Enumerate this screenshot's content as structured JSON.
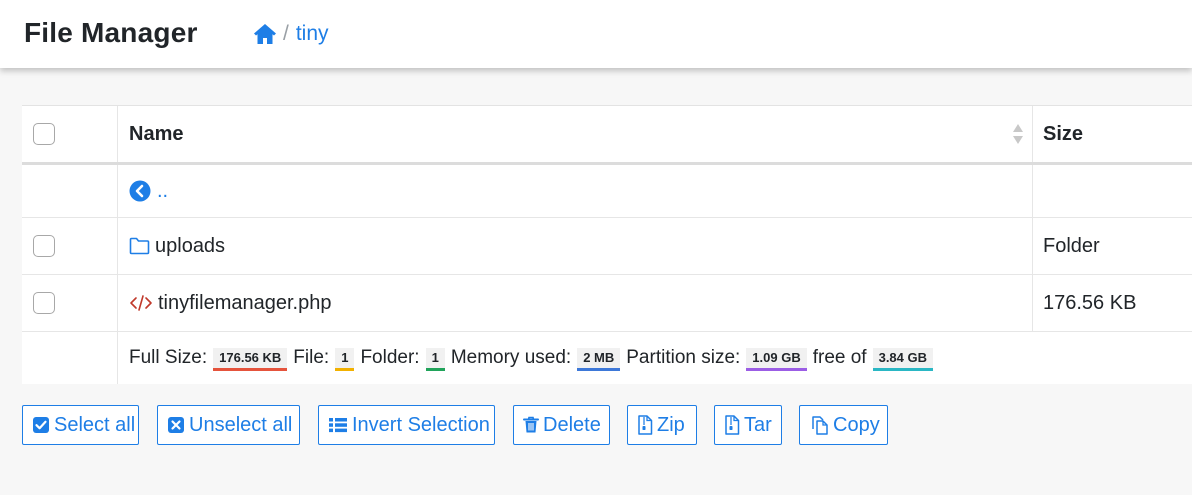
{
  "header": {
    "title": "File Manager",
    "breadcrumb": {
      "home_icon": "home-icon",
      "separator": "/",
      "current": "tiny"
    }
  },
  "table": {
    "columns": {
      "name": "Name",
      "size": "Size"
    },
    "up_row": {
      "icon": "chevron-circle-left-icon",
      "label": ".."
    },
    "rows": [
      {
        "icon": "folder-icon",
        "name": "uploads",
        "size": "Folder"
      },
      {
        "icon": "code-icon",
        "name": "tinyfilemanager.php",
        "size": "176.56 KB"
      }
    ],
    "footer": {
      "full_size_label": "Full Size:",
      "full_size": "176.56 KB",
      "file_label": "File:",
      "file_count": "1",
      "folder_label": "Folder:",
      "folder_count": "1",
      "memory_label": "Memory used:",
      "memory": "2 MB",
      "partition_label": "Partition size:",
      "partition": "1.09 GB",
      "free_label": "free of",
      "total": "3.84 GB"
    }
  },
  "actions": {
    "select_all": "Select all",
    "unselect_all": "Unselect all",
    "invert": "Invert Selection",
    "delete": "Delete",
    "zip": "Zip",
    "tar": "Tar",
    "copy": "Copy"
  },
  "colors": {
    "link": "#1e7ee6",
    "code_icon": "#c0392b",
    "badge_full_size": "#e5533c",
    "badge_file": "#f2b100",
    "badge_folder": "#20a35a",
    "badge_memory": "#3d78d8",
    "badge_partition": "#9b5de5",
    "badge_total": "#2ab7c4"
  }
}
